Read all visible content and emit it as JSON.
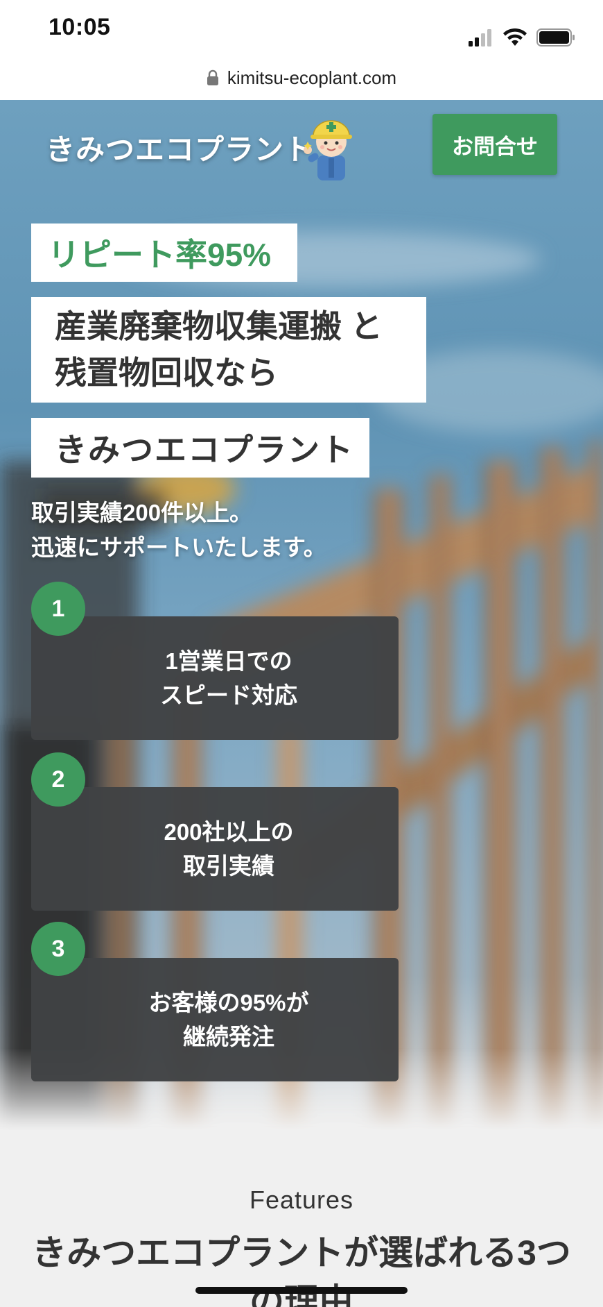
{
  "status_bar": {
    "time": "10:05",
    "signal_icon": "cellular-signal-icon",
    "wifi_icon": "wifi-icon",
    "battery_icon": "battery-icon"
  },
  "browser": {
    "url": "kimitsu-ecoplant.com",
    "lock_icon": "lock-icon"
  },
  "header": {
    "logo_text": "きみつエコプラント",
    "mascot": "mascot-illustration",
    "contact_label": "お問合せ"
  },
  "hero": {
    "repeat_tag": "リピート率95%",
    "headline_line1": "産業廃棄物収集運搬 と",
    "headline_line2": "残置物回収なら",
    "company_tag": "きみつエコプラント",
    "desc_line1": "取引実績200件以上。",
    "desc_line2": "迅速にサポートいたします。",
    "features": [
      {
        "number": "1",
        "line1": "1営業日での",
        "line2": "スピード対応"
      },
      {
        "number": "2",
        "line1": "200社以上の",
        "line2": "取引実績"
      },
      {
        "number": "3",
        "line1": "お客様の95%が",
        "line2": "継続発注"
      }
    ]
  },
  "features_section": {
    "eyebrow": "Features",
    "title_line1": "きみつエコプラントが選ばれる3つ",
    "title_line2": "の理由"
  },
  "colors": {
    "accent_green": "#3f9a5e",
    "card_dark": "#404244",
    "sky_blue": "#6ea0bf"
  }
}
